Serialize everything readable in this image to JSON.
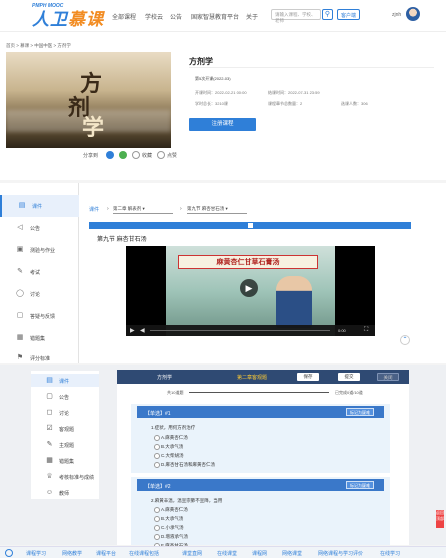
{
  "header": {
    "logo_main": "人卫",
    "logo_accent": "慕课",
    "logo_sub": "PMPH MOOC",
    "nav": [
      "全部课程",
      "学校云",
      "公告",
      "国家智慧教育平台",
      "关于"
    ],
    "search_placeholder": "请输入课程、学校、老师",
    "app_label": "客户端",
    "user_name": "zjnh"
  },
  "breadcrumb": "首页 > 慕课 > 中国中医 > 方剂学",
  "cover": {
    "chars": [
      "方",
      "剂",
      "学"
    ]
  },
  "share": {
    "label": "分享到",
    "collect": "收藏",
    "like": "点赞"
  },
  "course": {
    "title": "方剂学",
    "term": "第5次开课(2022-03)",
    "start": "开课时间：2022-02-21 00:00",
    "end": "结课时间：2022-07-31 23:59",
    "hours": "学时总长：3210课",
    "units": "课程章节总数量：2",
    "enrolled": "选课人数：306",
    "enroll_button": "注册课程"
  },
  "sidebar": {
    "items": [
      {
        "label": "课件",
        "icon": "book-icon",
        "active": true
      },
      {
        "label": "公告",
        "icon": "megaphone-icon"
      },
      {
        "label": "测验与作业",
        "icon": "clipboard-icon"
      },
      {
        "label": "考试",
        "icon": "exam-icon"
      },
      {
        "label": "讨论",
        "icon": "chat-icon"
      },
      {
        "label": "答疑与反馈",
        "icon": "question-icon"
      },
      {
        "label": "错题集",
        "icon": "notebook-icon"
      },
      {
        "label": "评分标准",
        "icon": "flag-icon"
      }
    ]
  },
  "player": {
    "toolbar_label": "课件",
    "chapter_select": "第二章 解表剂",
    "lesson_select": "第九节 麻杏甘石汤",
    "section_title": "第九节 麻杏甘石汤",
    "video_caption": "麻黄杏仁甘草石膏汤",
    "time_display": "0:00"
  },
  "quiz": {
    "sidebar": [
      {
        "label": "课件",
        "icon": "book-icon",
        "active": true
      },
      {
        "label": "公告",
        "icon": "megaphone-icon"
      },
      {
        "label": "讨论",
        "icon": "chat-icon"
      },
      {
        "label": "客观题",
        "icon": "check-icon"
      },
      {
        "label": "主观题",
        "icon": "pencil-icon"
      },
      {
        "label": "错题集",
        "icon": "notebook-icon"
      },
      {
        "label": "考核标准与成绩",
        "icon": "trophy-icon"
      },
      {
        "label": "教师",
        "icon": "person-icon"
      }
    ],
    "header_title": "方剂学",
    "header_chapter": "第二章客观题",
    "btn_prev": "保存",
    "btn_next": "提交",
    "btn_close": "关闭",
    "progress_left": "共10道题",
    "progress_right": "已完成0道/10道",
    "questions": [
      {
        "num": "【单选】#1",
        "badge": "标记为疑难",
        "text": "1.症状，用何方剂治疗",
        "options": [
          "A.麻黄杏仁汤",
          "B.大承气汤",
          "C.大柴胡汤",
          "D.麻杏甘石汤和麻黄杏仁汤"
        ]
      },
      {
        "num": "【单选】#2",
        "badge": "标记为疑难",
        "text": "2.麻黄辛温，温宣宗肺不宣降，当用",
        "options": [
          "A.麻黄杏仁汤",
          "B.大承气汤",
          "C.小承气汤",
          "D.增液承气汤",
          "E.麻杏甘石汤"
        ]
      }
    ]
  },
  "footer": [
    "课程学习",
    "网络教学",
    "课程平台",
    "在线课程包括",
    "课堂直网",
    "在线课堂",
    "课程网",
    "网络课堂",
    "网络课程与学习评价",
    "在线学习"
  ],
  "float_box": "返回顶部"
}
